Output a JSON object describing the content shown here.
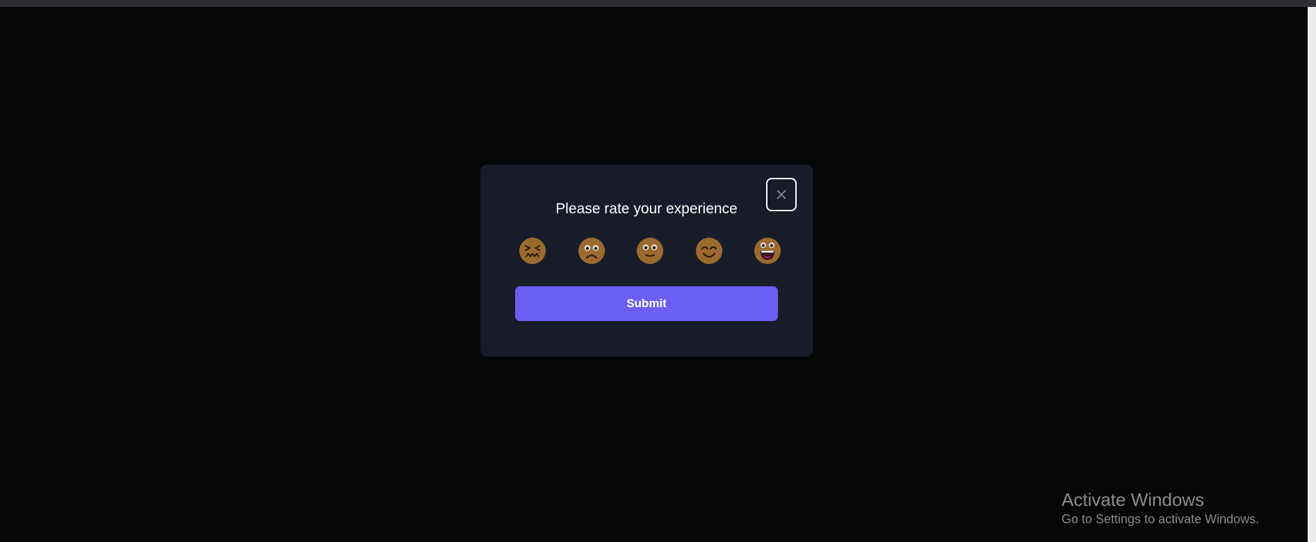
{
  "modal": {
    "title": "Please rate your experience",
    "close_icon": "close-icon",
    "ratings": [
      {
        "name": "emoji-1",
        "icon": "confounded-face-icon"
      },
      {
        "name": "emoji-2",
        "icon": "frowning-face-icon"
      },
      {
        "name": "emoji-3",
        "icon": "neutral-face-icon"
      },
      {
        "name": "emoji-4",
        "icon": "smiling-face-icon"
      },
      {
        "name": "emoji-5",
        "icon": "grinning-face-icon"
      }
    ],
    "submit_label": "Submit"
  },
  "watermark": {
    "title": "Activate Windows",
    "subtitle": "Go to Settings to activate Windows."
  },
  "colors": {
    "background": "#050608",
    "modal": "#171c28",
    "accent": "#6a5ff2",
    "emoji_face": "#9a6a2e"
  }
}
